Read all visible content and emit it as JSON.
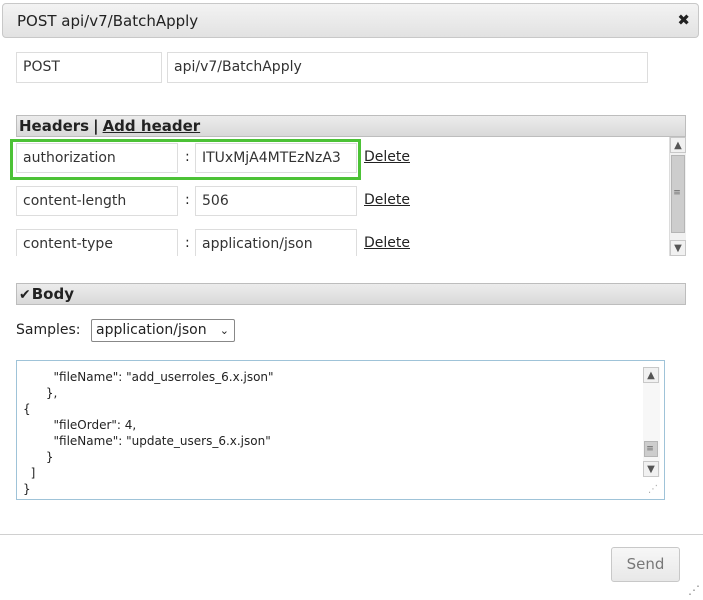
{
  "dialog": {
    "title": "POST api/v7/BatchApply",
    "close_glyph": "✖"
  },
  "request": {
    "method": "POST",
    "url": "api/v7/BatchApply"
  },
  "headers_section": {
    "title": "Headers",
    "separator": "|",
    "add_label": "Add header",
    "rows": [
      {
        "key": "authorization",
        "value": "ITUxMjA4MTEzNzA3",
        "delete_label": "Delete"
      },
      {
        "key": "content-length",
        "value": "506",
        "delete_label": "Delete"
      },
      {
        "key": "content-type",
        "value": "application/json",
        "delete_label": "Delete"
      }
    ],
    "colon": ":"
  },
  "body_section": {
    "checkbox_glyph": "✔",
    "title": "Body",
    "samples_label": "Samples:",
    "samples_selected": "application/json",
    "code": "        \"fileName\": \"add_userroles_6.x.json\"\n      },\n{\n        \"fileOrder\": 4,\n        \"fileName\": \"update_users_6.x.json\"\n      }\n  ]\n}"
  },
  "footer": {
    "send_label": "Send"
  },
  "colors": {
    "highlight": "#4cc236",
    "code_border": "#9fc3d8"
  }
}
